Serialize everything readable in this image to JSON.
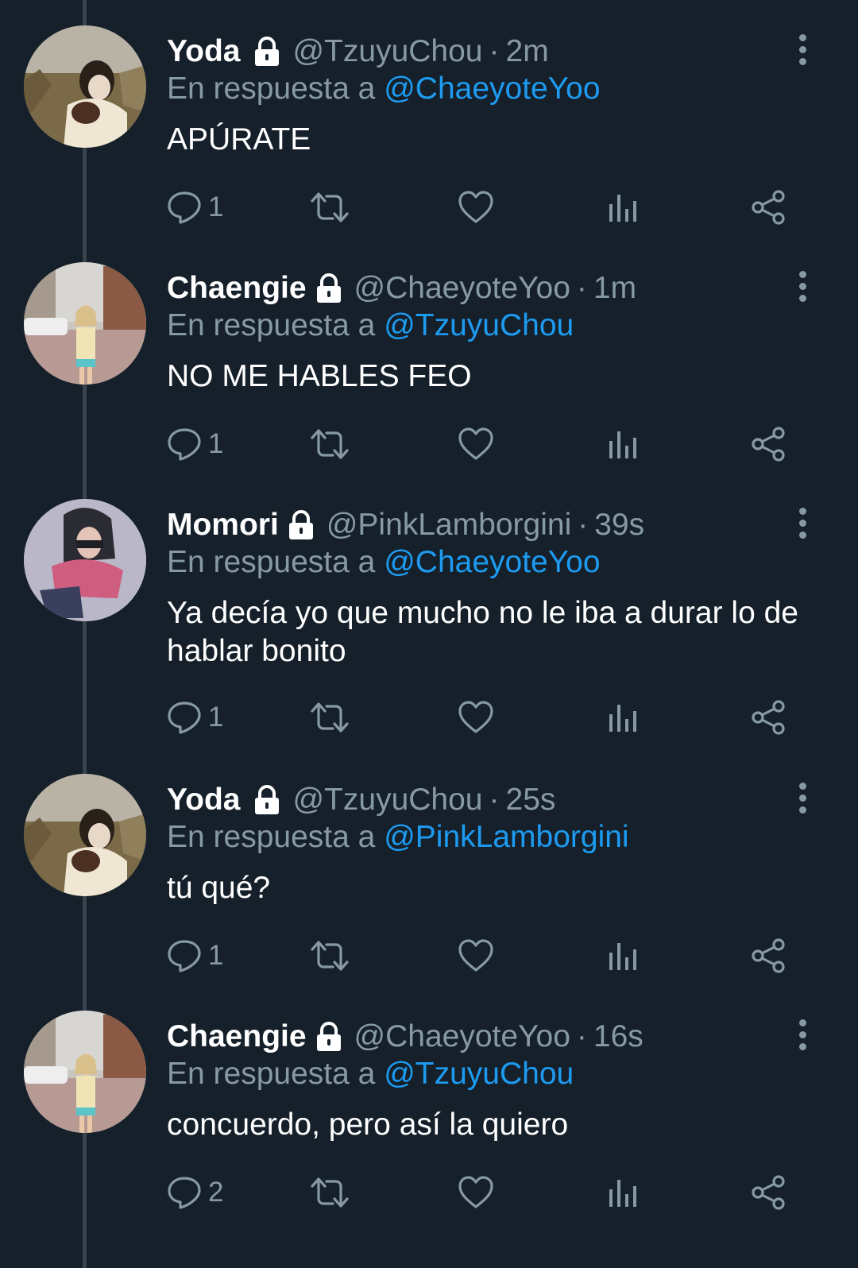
{
  "tweets": [
    {
      "name": "Yoda",
      "handle": "@TzuyuChou",
      "separator": "·",
      "time": "2m",
      "reply_prefix": "En respuesta a",
      "reply_to": "@ChaeyoteYoo",
      "text": "APÚRATE",
      "reply_count": "1",
      "avatar_icon": "avatar-photo-yoda"
    },
    {
      "name": "Chaengie",
      "handle": "@ChaeyoteYoo",
      "separator": "·",
      "time": "1m",
      "reply_prefix": "En respuesta a",
      "reply_to": "@TzuyuChou",
      "text": "NO ME HABLES FEO",
      "reply_count": "1",
      "avatar_icon": "avatar-photo-chaengie"
    },
    {
      "name": "Momori",
      "handle": "@PinkLamborgini",
      "separator": "·",
      "time": "39s",
      "reply_prefix": "En respuesta a",
      "reply_to": "@ChaeyoteYoo",
      "text": "Ya decía yo que mucho no le iba a durar lo de hablar bonito",
      "reply_count": "1",
      "avatar_icon": "avatar-photo-momori"
    },
    {
      "name": "Yoda",
      "handle": "@TzuyuChou",
      "separator": "·",
      "time": "25s",
      "reply_prefix": "En respuesta a",
      "reply_to": "@PinkLamborgini",
      "text": "tú qué?",
      "reply_count": "1",
      "avatar_icon": "avatar-photo-yoda"
    },
    {
      "name": "Chaengie",
      "handle": "@ChaeyoteYoo",
      "separator": "·",
      "time": "16s",
      "reply_prefix": "En respuesta a",
      "reply_to": "@TzuyuChou",
      "text": "concuerdo, pero así la quiero",
      "reply_count": "2",
      "avatar_icon": "avatar-photo-chaengie"
    }
  ],
  "icons": {
    "lock": "lock-icon",
    "reply": "reply-icon",
    "retweet": "retweet-icon",
    "like": "heart-icon",
    "views": "views-icon",
    "share": "share-icon",
    "more": "more-vertical-icon"
  },
  "colors": {
    "background": "#15202b",
    "text_primary": "#ffffff",
    "text_secondary": "#8899a6",
    "link": "#1d9bf0",
    "thread_line": "#38444d"
  }
}
